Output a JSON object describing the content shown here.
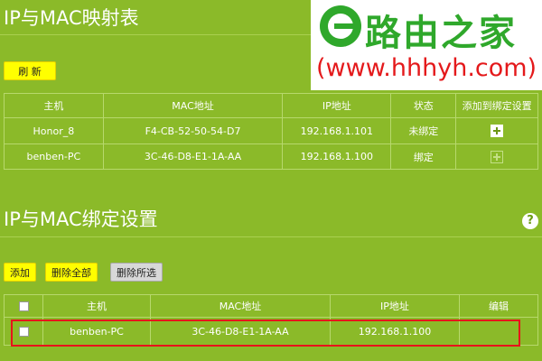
{
  "mapping_section": {
    "title": "IP与MAC映射表",
    "refresh_label": "刷 新",
    "columns": [
      "主机",
      "MAC地址",
      "IP地址",
      "状态",
      "添加到绑定设置"
    ],
    "rows": [
      {
        "host": "Honor_8",
        "mac": "F4-CB-52-50-54-D7",
        "ip": "192.168.1.101",
        "status": "未绑定",
        "add_enabled": true
      },
      {
        "host": "benben-PC",
        "mac": "3C-46-D8-E1-1A-AA",
        "ip": "192.168.1.100",
        "status": "绑定",
        "add_enabled": false
      }
    ]
  },
  "binding_section": {
    "title": "IP与MAC绑定设置",
    "help_label": "?",
    "add_label": "添加",
    "delete_all_label": "删除全部",
    "delete_selected_label": "删除所选",
    "columns": [
      "主机",
      "MAC地址",
      "IP地址",
      "编辑"
    ],
    "rows": [
      {
        "host": "benben-PC",
        "mac": "3C-46-D8-E1-1A-AA",
        "ip": "192.168.1.100",
        "edit": ""
      }
    ]
  },
  "watermark": {
    "title": "路由之家",
    "url": "(www.hhhyh.com)"
  },
  "colors": {
    "background": "#8bba29",
    "button_yellow": "#ffff00",
    "highlight_border": "#e8131b",
    "watermark_green": "#2fa82b",
    "watermark_red": "#e4191b"
  }
}
